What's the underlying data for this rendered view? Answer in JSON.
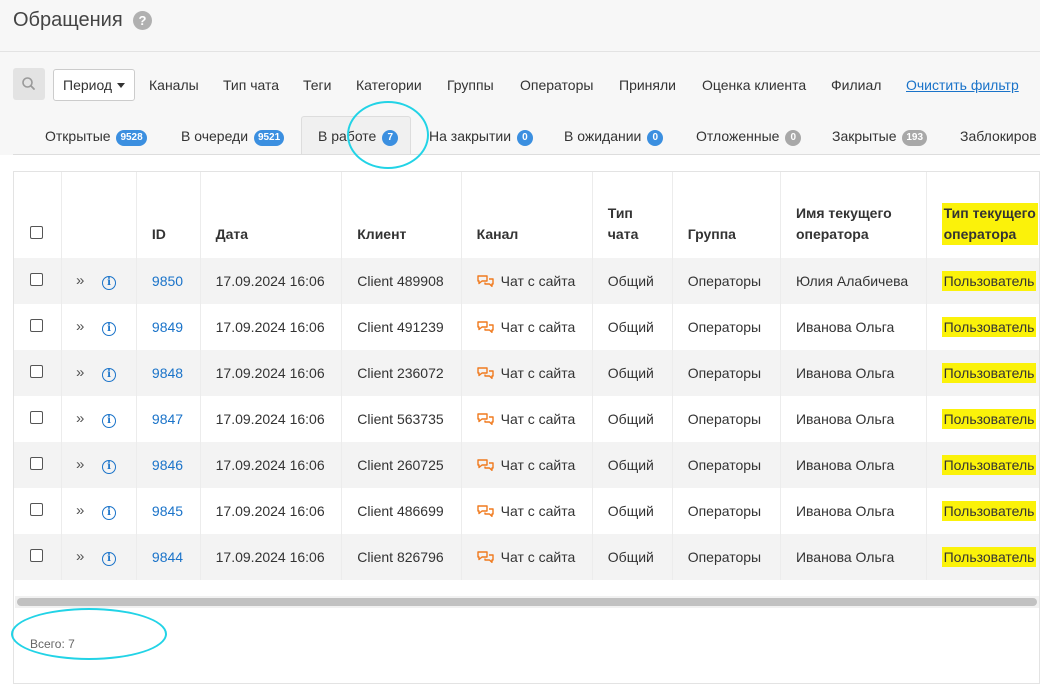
{
  "page": {
    "title": "Обращения",
    "help_icon": "question-circle-icon"
  },
  "filters": {
    "search_icon": "search-icon",
    "period": "Период",
    "links": [
      "Каналы",
      "Тип чата",
      "Теги",
      "Категории",
      "Группы",
      "Операторы",
      "Приняли",
      "Оценка клиента",
      "Филиал"
    ],
    "clear": "Очистить фильтр"
  },
  "tabs": [
    {
      "label": "Открытые",
      "count": "9528",
      "badge": "blue"
    },
    {
      "label": "В очереди",
      "count": "9521",
      "badge": "blue"
    },
    {
      "label": "В работе",
      "count": "7",
      "badge": "blue",
      "active": true
    },
    {
      "label": "На закрытии",
      "count": "0",
      "badge": "blue"
    },
    {
      "label": "В ожидании",
      "count": "0",
      "badge": "blue"
    },
    {
      "label": "Отложенные",
      "count": "0",
      "badge": "grey"
    },
    {
      "label": "Закрытые",
      "count": "193",
      "badge": "grey"
    },
    {
      "label": "Заблокиров",
      "count": "",
      "badge": ""
    }
  ],
  "table": {
    "columns": {
      "id": "ID",
      "date": "Дата",
      "client": "Клиент",
      "channel": "Канал",
      "chat_type": "Тип чата",
      "group": "Группа",
      "operator": "Имя текущего оператора",
      "operator_type": "Тип текущего оператора"
    },
    "rows": [
      {
        "id": "9850",
        "date": "17.09.2024 16:06",
        "client": "Client 489908",
        "channel": "Чат с сайта",
        "chat_type": "Общий",
        "group": "Операторы",
        "operator": "Юлия Алабичева",
        "operator_type": "Пользователь"
      },
      {
        "id": "9849",
        "date": "17.09.2024 16:06",
        "client": "Client 491239",
        "channel": "Чат с сайта",
        "chat_type": "Общий",
        "group": "Операторы",
        "operator": "Иванова Ольга",
        "operator_type": "Пользователь"
      },
      {
        "id": "9848",
        "date": "17.09.2024 16:06",
        "client": "Client 236072",
        "channel": "Чат с сайта",
        "chat_type": "Общий",
        "group": "Операторы",
        "operator": "Иванова Ольга",
        "operator_type": "Пользователь"
      },
      {
        "id": "9847",
        "date": "17.09.2024 16:06",
        "client": "Client 563735",
        "channel": "Чат с сайта",
        "chat_type": "Общий",
        "group": "Операторы",
        "operator": "Иванова Ольга",
        "operator_type": "Пользователь"
      },
      {
        "id": "9846",
        "date": "17.09.2024 16:06",
        "client": "Client 260725",
        "channel": "Чат с сайта",
        "chat_type": "Общий",
        "group": "Операторы",
        "operator": "Иванова Ольга",
        "operator_type": "Пользователь"
      },
      {
        "id": "9845",
        "date": "17.09.2024 16:06",
        "client": "Client 486699",
        "channel": "Чат с сайта",
        "chat_type": "Общий",
        "group": "Операторы",
        "operator": "Иванова Ольга",
        "operator_type": "Пользователь"
      },
      {
        "id": "9844",
        "date": "17.09.2024 16:06",
        "client": "Client 826796",
        "channel": "Чат с сайта",
        "chat_type": "Общий",
        "group": "Операторы",
        "operator": "Иванова Ольга",
        "operator_type": "Пользователь"
      }
    ]
  },
  "footer": {
    "total": "Всего: 7"
  },
  "colors": {
    "link": "#1a73c9",
    "badge_blue": "#3b8fe0",
    "badge_grey": "#a8a8a8",
    "highlight": "#fbf20a",
    "annotation": "#22d3e6",
    "channel_icon": "#f07a1e"
  }
}
